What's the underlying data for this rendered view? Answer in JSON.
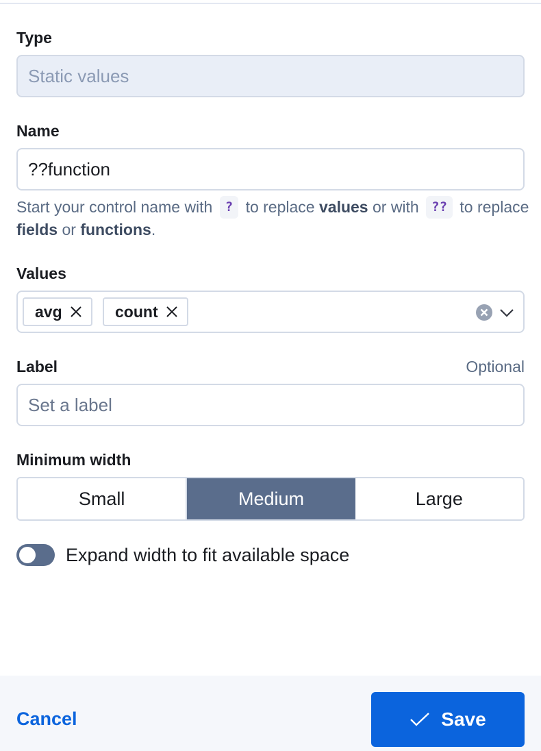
{
  "form": {
    "type": {
      "label": "Type",
      "value": "Static values"
    },
    "name": {
      "label": "Name",
      "value": "??function",
      "help": {
        "part1": "Start your control name with",
        "code1": "?",
        "part2": "to replace",
        "bold1": "values",
        "part3": "or with",
        "code2": "??",
        "part4": "to replace",
        "bold2": "fields",
        "part5": "or",
        "bold3": "functions",
        "part6": "."
      }
    },
    "values": {
      "label": "Values",
      "chips": [
        "avg",
        "count"
      ]
    },
    "label_field": {
      "label": "Label",
      "optional": "Optional",
      "placeholder": "Set a label"
    },
    "min_width": {
      "label": "Minimum width",
      "options": [
        "Small",
        "Medium",
        "Large"
      ],
      "selected": "Medium"
    },
    "expand": {
      "label": "Expand width to fit available space",
      "enabled": false
    }
  },
  "footer": {
    "cancel": "Cancel",
    "save": "Save"
  },
  "colors": {
    "primary": "#0b64dd",
    "selected_segment": "#5a6d8c"
  }
}
